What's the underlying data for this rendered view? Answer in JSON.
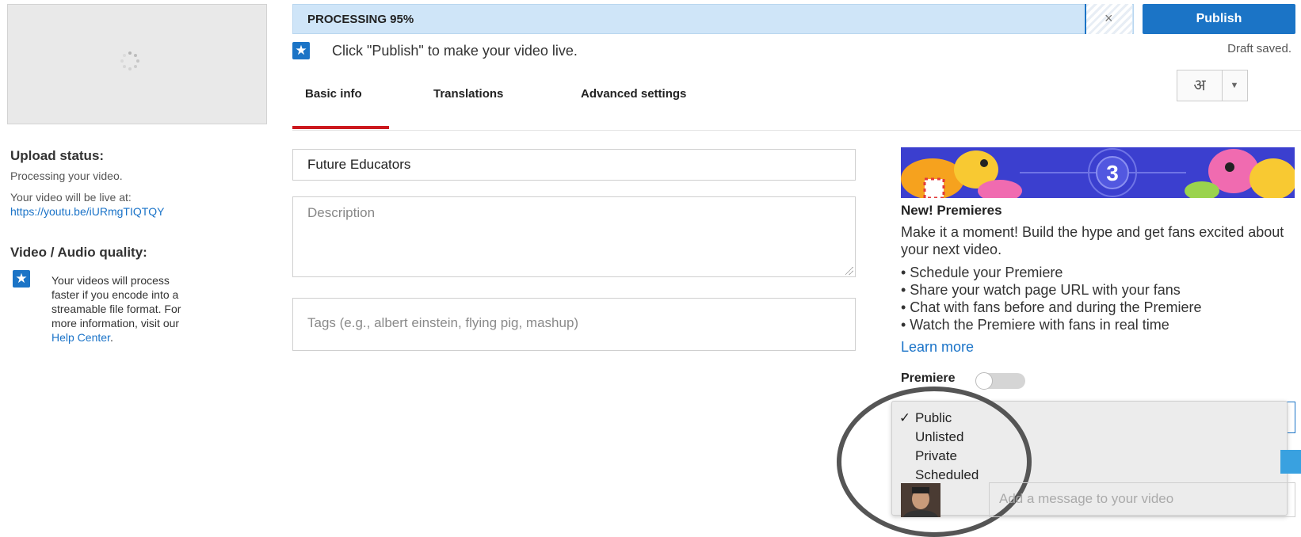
{
  "upload": {
    "status_heading": "Upload status:",
    "status_text": "Processing your video.",
    "live_at_text": "Your video will be live at:",
    "video_url": "https://youtu.be/iURmgTIQTQY",
    "quality_heading": "Video / Audio quality:",
    "quality_line1": "Your videos will process",
    "quality_line2": "faster if you encode into a",
    "quality_line3": "streamable file format. For",
    "quality_line4": "more information, visit our",
    "help_center_link": "Help Center"
  },
  "progress": {
    "label": "PROCESSING 95%",
    "percent": 95,
    "cancel_icon": "×"
  },
  "header": {
    "publish_label": "Publish",
    "draft_status": "Draft saved.",
    "language_glyph": "अ",
    "language_caret": "▼",
    "hint_star": "★",
    "hint_text": "Click \"Publish\" to make your video live."
  },
  "tabs": [
    {
      "label": "Basic info",
      "active": true
    },
    {
      "label": "Translations",
      "active": false
    },
    {
      "label": "Advanced settings",
      "active": false
    }
  ],
  "form": {
    "title_value": "Future Educators",
    "description_placeholder": "Description",
    "tags_placeholder": "Tags (e.g., albert einstein, flying pig, mashup)"
  },
  "premieres": {
    "banner_number": "3",
    "title": "New! Premieres",
    "description": "Make it a moment! Build the hype and get fans excited about your next video.",
    "bullets": [
      "• Schedule your Premiere",
      "• Share your watch page URL with your fans",
      "• Chat with fans before and during the Premiere",
      "• Watch the Premiere with fans in real time"
    ],
    "learn_more": "Learn more",
    "toggle_label": "Premiere",
    "toggle_on": false
  },
  "visibility": {
    "options": [
      {
        "label": "Public",
        "check": "✓"
      },
      {
        "label": "Unlisted",
        "check": ""
      },
      {
        "label": "Private",
        "check": ""
      },
      {
        "label": "Scheduled",
        "check": ""
      }
    ],
    "selected": "Public"
  },
  "share": {
    "message_placeholder": "Add a message to your video"
  },
  "colors": {
    "accent_blue": "#1b74c6",
    "progress_bg": "#cfe5f8",
    "tab_underline": "#cc181e",
    "link_blue": "#1a73c8"
  }
}
